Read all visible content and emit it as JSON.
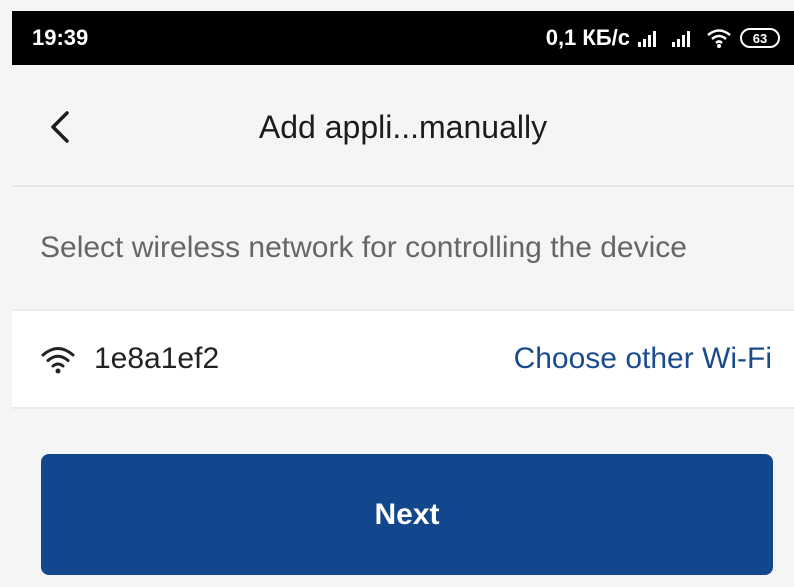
{
  "status_bar": {
    "time": "19:39",
    "speed": "0,1 КБ/с",
    "battery": "63"
  },
  "header": {
    "title": "Add appli...manually"
  },
  "instruction": "Select wireless network for controlling the device",
  "wifi": {
    "ssid": "1e8a1ef2",
    "choose_other": "Choose other Wi-Fi"
  },
  "next_button": "Next",
  "colors": {
    "accent": "#12478d",
    "link": "#1b4b8f",
    "background": "#f5f5f5"
  }
}
